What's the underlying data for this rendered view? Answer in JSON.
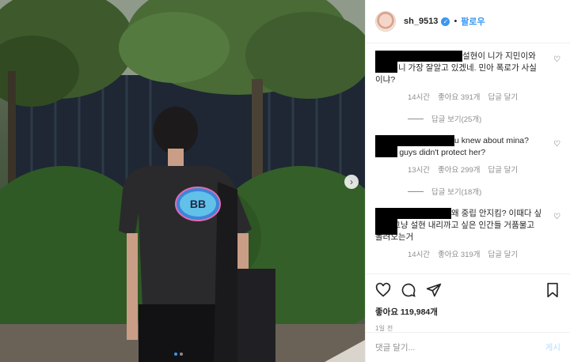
{
  "header": {
    "username": "sh_9513",
    "follow_label": "팔로우",
    "separator": "•"
  },
  "photo": {
    "shirt_logo_text": "BB",
    "carousel_dots": 2
  },
  "comments": [
    {
      "text": "설현이 니가 지민이와 단짝이니 가장 잘알고 있겠네. 민아 폭로가 사실이냐?",
      "time": "14시간",
      "likes": "좋아요 391개",
      "reply": "답글 달기",
      "view_replies": "답글 보기(25개)"
    },
    {
      "text": "u knew about mina? why u guys didn't protect her?",
      "time": "13시간",
      "likes": "좋아요 299개",
      "reply": "답글 달기",
      "view_replies": "답글 보기(18개)"
    },
    {
      "text": "왜 중립 안지킴? 이때다 싶어서 그냥 설현 내리까고 싶은 인간들 거품물고 몰려오는거",
      "time": "14시간",
      "likes": "좋아요 319개",
      "reply": "답글 달기",
      "view_replies": ""
    }
  ],
  "actions": {
    "likes": "좋아요 119,984개",
    "time_ago": "1일 전"
  },
  "add_comment": {
    "placeholder": "댓글 달기...",
    "post_label": "게시"
  },
  "colors": {
    "accent": "#3897f0",
    "muted": "#8e8e8e",
    "text": "#262626"
  }
}
